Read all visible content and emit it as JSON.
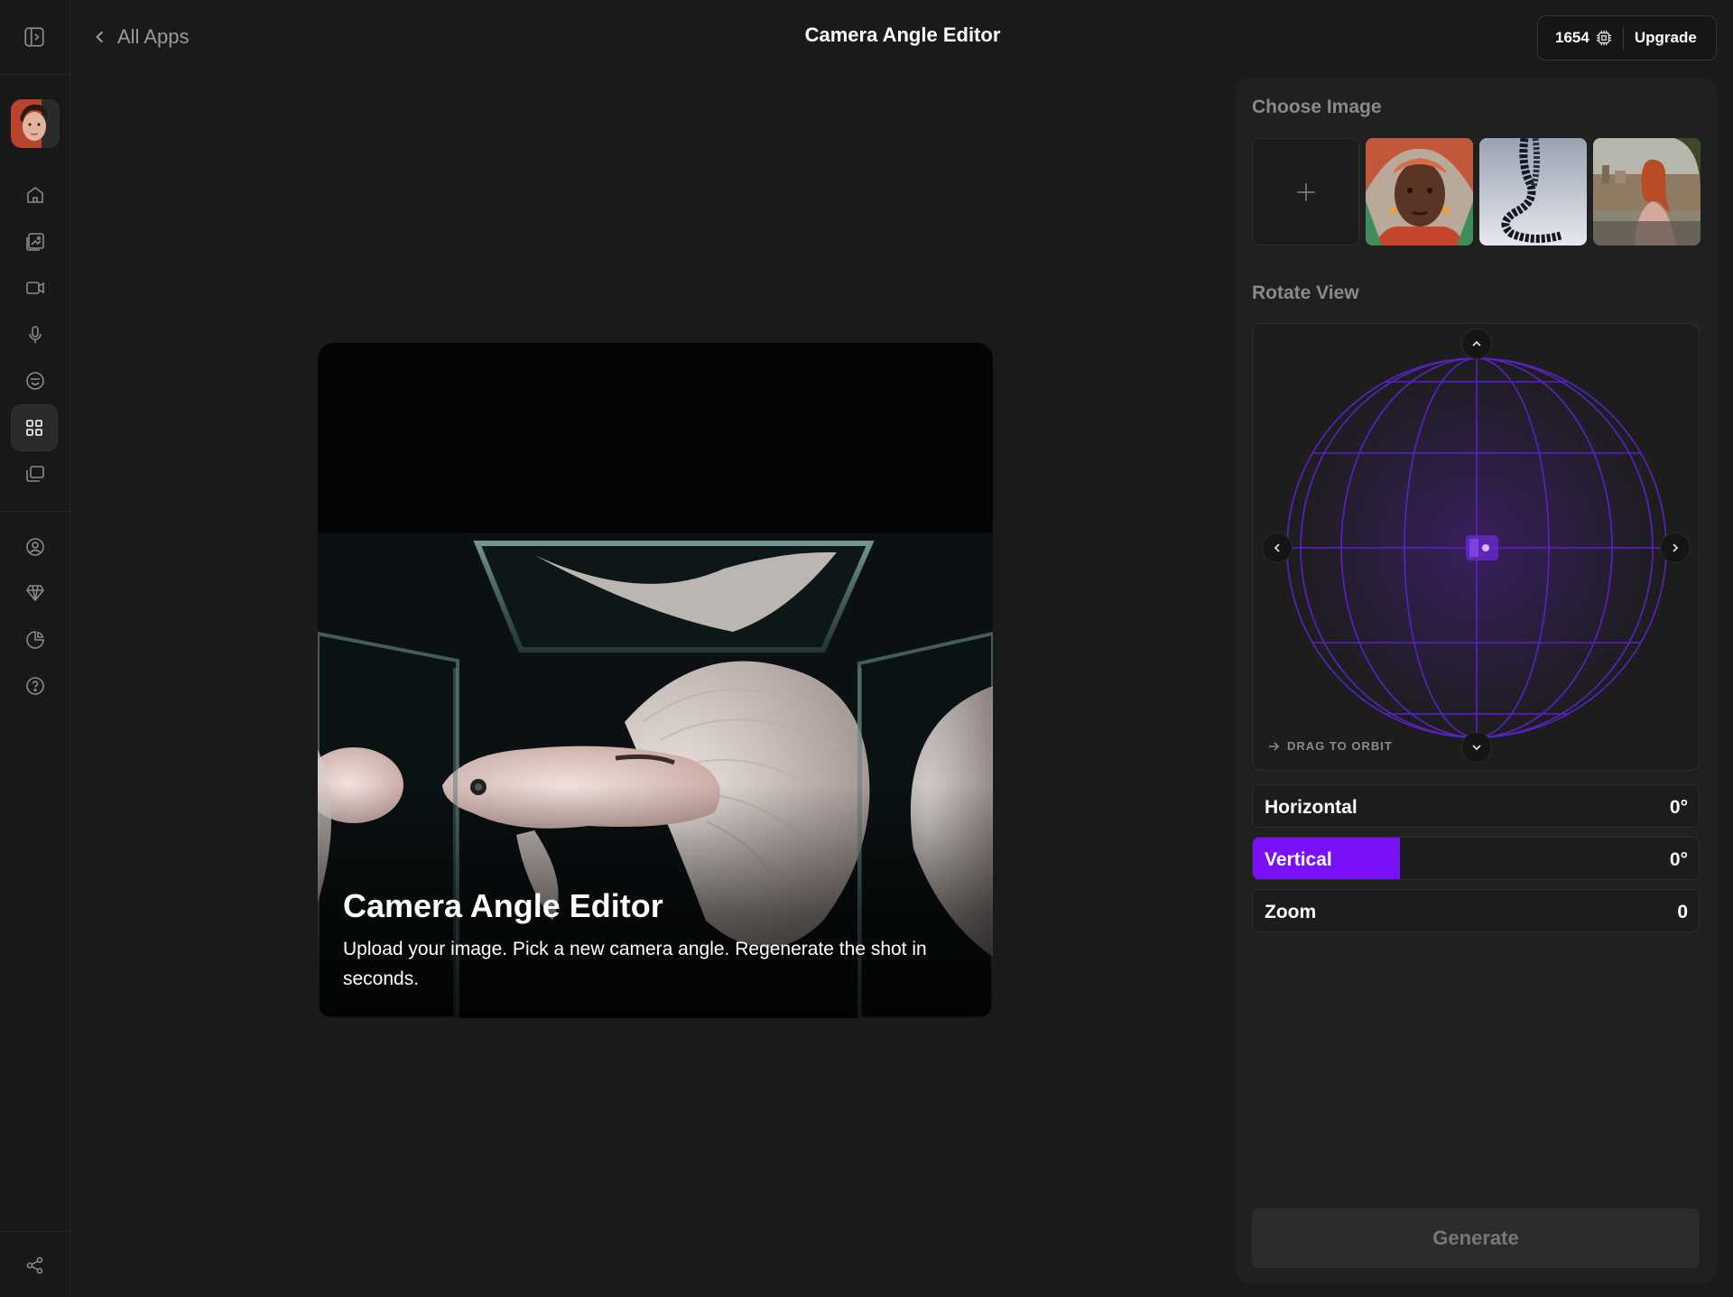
{
  "header": {
    "back_label": "All Apps",
    "title": "Camera Angle Editor",
    "credits": "1654",
    "upgrade_label": "Upgrade"
  },
  "sidebar": {
    "items": [
      {
        "icon": "home-icon"
      },
      {
        "icon": "image-edit-icon"
      },
      {
        "icon": "video-camera-icon"
      },
      {
        "icon": "microphone-icon"
      },
      {
        "icon": "face-icon"
      },
      {
        "icon": "apps-grid-icon",
        "active": true
      },
      {
        "icon": "gallery-icon"
      },
      {
        "icon": "profile-icon"
      },
      {
        "icon": "diamond-icon"
      },
      {
        "icon": "usage-pie-icon"
      },
      {
        "icon": "help-icon"
      }
    ],
    "bottom_icon": "share-icon"
  },
  "preview": {
    "title": "Camera Angle Editor",
    "description": "Upload your image. Pick a new camera angle. Regenerate the shot in seconds."
  },
  "panel": {
    "choose_image_label": "Choose Image",
    "thumbnails": [
      "woman-portrait",
      "beaded-necklace",
      "woman-city-view"
    ],
    "rotate_view_label": "Rotate View",
    "drag_hint": "DRAG TO ORBIT",
    "controls": [
      {
        "label": "Horizontal",
        "value": "0°",
        "fill": 0
      },
      {
        "label": "Vertical",
        "value": "0°",
        "fill": 0.33
      },
      {
        "label": "Zoom",
        "value": "0",
        "fill": 0
      }
    ],
    "generate_label": "Generate"
  },
  "colors": {
    "accent": "#7a10f7",
    "background": "#1a1a1a",
    "panel": "#202020"
  }
}
